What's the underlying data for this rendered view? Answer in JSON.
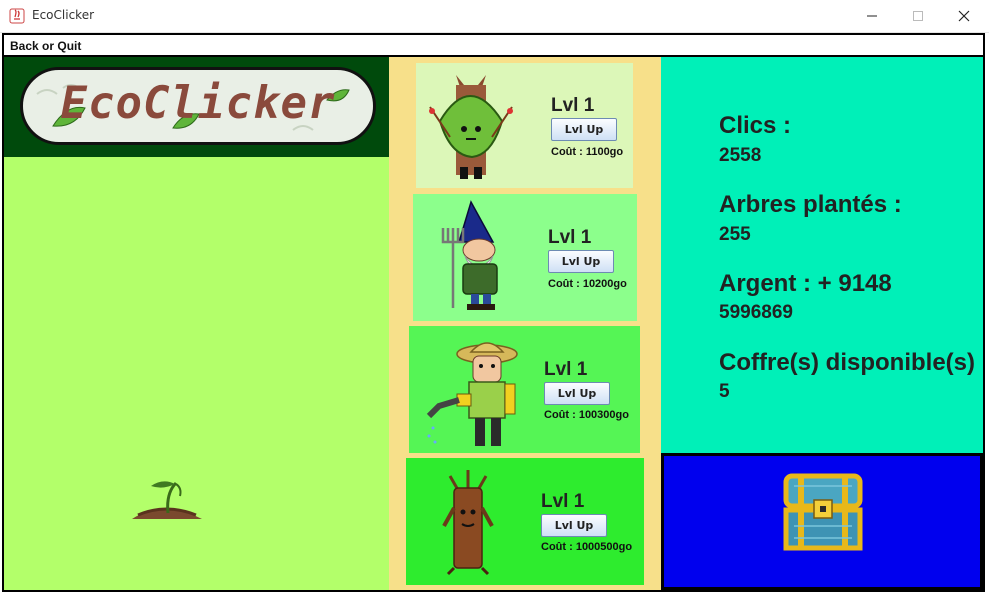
{
  "window": {
    "title": "EcoClicker"
  },
  "menu": {
    "label": "Back or Quit"
  },
  "logo": {
    "text": "EcoClicker"
  },
  "field": {
    "sprout_icon": "sprout-icon"
  },
  "shop": {
    "cards": [
      {
        "icon": "leaf-spirit-icon",
        "level": "Lvl 1",
        "button": "Lvl Up",
        "cost": "Coût : 1100go",
        "bg": "#dcf7b8"
      },
      {
        "icon": "gnome-icon",
        "level": "Lvl 1",
        "button": "Lvl Up",
        "cost": "Coût : 10200go",
        "bg": "#8cff8c"
      },
      {
        "icon": "gardener-icon",
        "level": "Lvl 1",
        "button": "Lvl Up",
        "cost": "Coût : 100300go",
        "bg": "#55f555"
      },
      {
        "icon": "treant-icon",
        "level": "Lvl 1",
        "button": "Lvl Up",
        "cost": "Coût : 1000500go",
        "bg": "#2eec2e"
      }
    ]
  },
  "stats": {
    "clicks_label": "Clics :",
    "clicks_value": "2558",
    "trees_label": "Arbres plantés :",
    "trees_value": "255",
    "money_label": "Argent :  + 9148",
    "money_value": "5996869",
    "chests_label": "Coffre(s) disponible(s)",
    "chests_value": "5"
  },
  "chest": {
    "icon": "treasure-chest-icon"
  },
  "colors": {
    "logo_bg": "#004a0c",
    "field_bg": "#b3ff6a",
    "shop_bg": "#f7e08a",
    "stats_bg": "#00f0b8",
    "chest_bg": "#0000ee"
  }
}
